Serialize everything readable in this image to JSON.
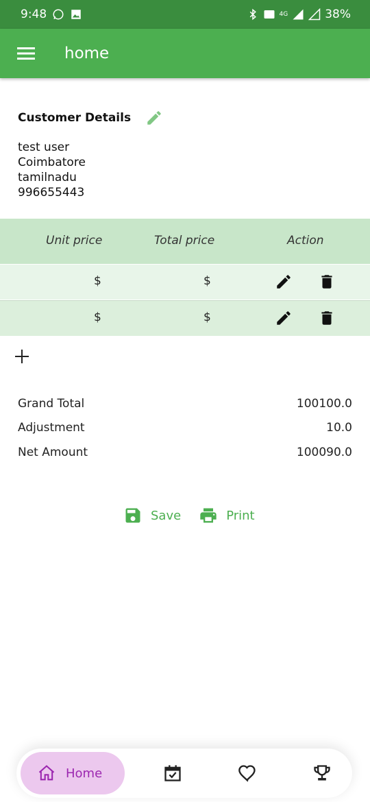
{
  "status_bar": {
    "time": "9:48",
    "battery": "38%",
    "network": "4G"
  },
  "app_bar": {
    "title": "home"
  },
  "customer": {
    "title": "Customer Details",
    "name": "test user",
    "city": "Coimbatore",
    "state": "tamilnadu",
    "phone": "996655443"
  },
  "table": {
    "headers": [
      "Unit price",
      "Total price",
      "Action"
    ],
    "rows": [
      {
        "unit_price": "$",
        "total_price": "$"
      },
      {
        "unit_price": "$",
        "total_price": "$"
      }
    ]
  },
  "totals": {
    "grand_total_label": "Grand Total",
    "grand_total_value": "100100.0",
    "adjustment_label": "Adjustment",
    "adjustment_value": "10.0",
    "net_amount_label": "Net Amount",
    "net_amount_value": "100090.0"
  },
  "actions": {
    "save": "Save",
    "print": "Print"
  },
  "bottom_nav": {
    "home": "Home"
  },
  "colors": {
    "primary": "#4caf50",
    "status_bar": "#3a8d3e",
    "header_bg": "#c8e6c9",
    "row_bg": "#e8f5e9",
    "nav_active": "#ecc8ee",
    "nav_active_text": "#9c27b0"
  }
}
